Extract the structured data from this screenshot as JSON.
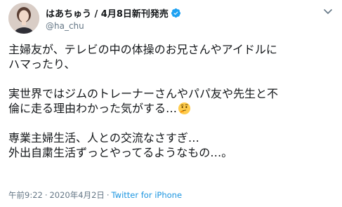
{
  "user": {
    "display_name": "はあちゅう / 4月8日新刊発売",
    "handle": "@ha_chu",
    "verified": true,
    "avatar_icon": "profile-photo",
    "verified_icon": "verified-badge-icon",
    "more_icon": "chevron-down-icon"
  },
  "tweet": {
    "lines": [
      "主婦友が、テレビの中の体操のお兄さんやアイドルに",
      "ハマったり、",
      "",
      "実世界ではジムのトレーナーさんやパパ友や先生と不",
      "倫に走る理由わかった気がする…",
      "",
      "専業主婦生活、人との交流なさすぎ…",
      "外出自粛生活ずっとやってるようなもの…。"
    ],
    "emoji": "thinking-face-icon"
  },
  "footer": {
    "time": "午前9:22",
    "date": "2020年4月2日",
    "separator": "·",
    "source": "Twitter for iPhone"
  },
  "colors": {
    "text": "#14171a",
    "secondary": "#657786",
    "link": "#1b95e0",
    "verified": "#1da1f2"
  }
}
